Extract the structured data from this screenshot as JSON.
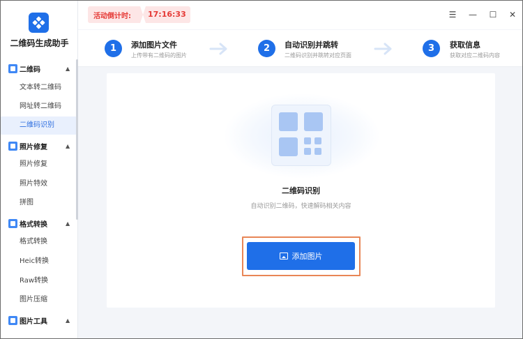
{
  "app": {
    "name": "二维码生成助手"
  },
  "countdown": {
    "label": "活动倒计时:",
    "time": "17:16:33"
  },
  "window_controls": {
    "menu": "☰",
    "minimize": "—",
    "maximize": "☐",
    "close": "✕"
  },
  "sidebar": {
    "groups": [
      {
        "label": "二维码",
        "items": [
          "文本转二维码",
          "网址转二维码",
          "二维码识别"
        ]
      },
      {
        "label": "照片修复",
        "items": [
          "照片修复",
          "照片特效",
          "拼图"
        ]
      },
      {
        "label": "格式转换",
        "items": [
          "格式转换",
          "Heic转换",
          "Raw转换",
          "图片压缩"
        ]
      },
      {
        "label": "图片工具",
        "items": []
      }
    ],
    "active_item": "二维码识别"
  },
  "steps": [
    {
      "num": "1",
      "title": "添加图片文件",
      "sub": "上传带有二维码的图片"
    },
    {
      "num": "2",
      "title": "自动识别并跳转",
      "sub": "二维码识别并跳转对应页面"
    },
    {
      "num": "3",
      "title": "获取信息",
      "sub": "获取对应二维码内容"
    }
  ],
  "main": {
    "title": "二维码识别",
    "description": "自动识别二维码，快速解码相关内容",
    "add_button": "添加图片"
  },
  "colors": {
    "accent": "#1f6fe8",
    "countdown_bg": "#fde6e6",
    "countdown_text": "#e53935",
    "highlight_outline": "#e88656"
  }
}
